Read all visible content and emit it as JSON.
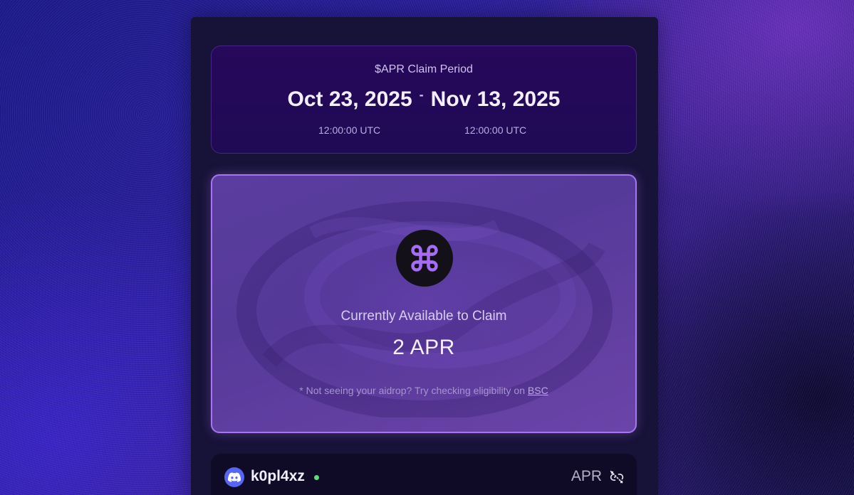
{
  "period": {
    "title": "$APR Claim Period",
    "start_date": "Oct 23, 2025",
    "separator": "-",
    "end_date": "Nov 13, 2025",
    "start_time": "12:00:00 UTC",
    "end_time": "12:00:00 UTC"
  },
  "claim": {
    "label": "Currently Available to Claim",
    "amount": "2 APR",
    "note_prefix": "* Not seeing your aidrop? Try checking eligibility on",
    "note_link": "BSC",
    "icon": "command-icon"
  },
  "user": {
    "username": "k0pl4xz",
    "status": "online",
    "token": "APR",
    "avatar_icon": "discord-icon",
    "action_icon": "unlink-icon"
  },
  "colors": {
    "accent": "#a774f2",
    "online": "#57e07b",
    "discord": "#5865f2"
  }
}
